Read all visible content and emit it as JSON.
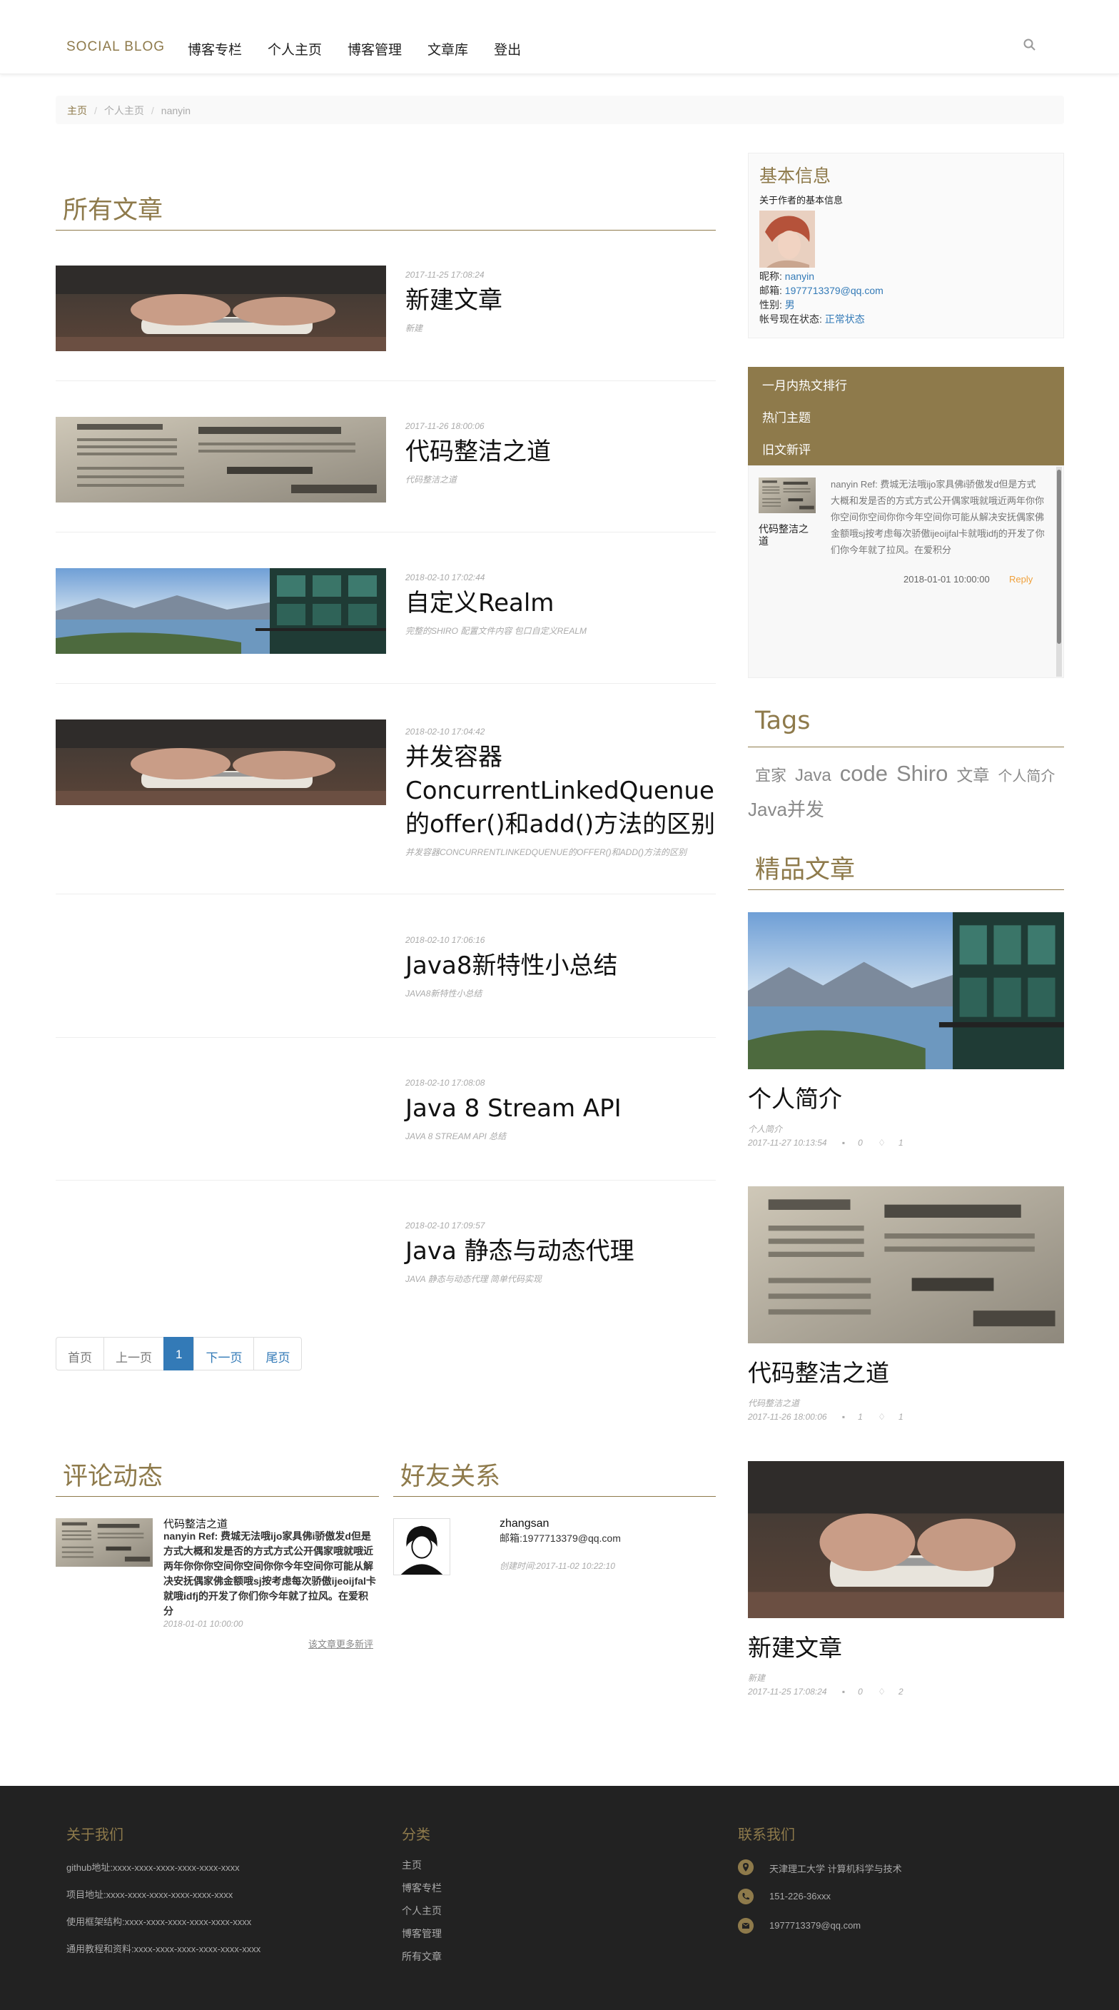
{
  "navbar": {
    "brand": "SOCIAL BLOG",
    "items": [
      "博客专栏",
      "个人主页",
      "博客管理",
      "文章库",
      "登出"
    ],
    "search_icon": "search-icon"
  },
  "breadcrumb": [
    "主页",
    "个人主页",
    "nanyin"
  ],
  "main": {
    "title": "所有文章",
    "posts": [
      {
        "date": "2017-11-25 17:08:24",
        "title": "新建文章",
        "summary": "新建"
      },
      {
        "date": "2017-11-26 18:00:06",
        "title": "代码整洁之道",
        "summary": "代码整洁之道"
      },
      {
        "date": "2018-02-10 17:02:44",
        "title": "自定义Realm",
        "summary": "完整的SHIRO 配置文件内容 包口自定义REALM"
      },
      {
        "date": "2018-02-10 17:04:42",
        "title": "并发容器ConcurrentLinkedQuenue的offer()和add()方法的区别",
        "summary": "并发容器CONCURRENTLINKEDQUENUE的OFFER()和ADD()方法的区别"
      },
      {
        "date": "2018-02-10 17:06:16",
        "title": "Java8新特性小总结",
        "summary": "JAVA8新特性小总结"
      },
      {
        "date": "2018-02-10 17:08:08",
        "title": "Java 8 Stream API",
        "summary": "JAVA 8 STREAM API 总结"
      },
      {
        "date": "2018-02-10 17:09:57",
        "title": "Java 静态与动态代理",
        "summary": "JAVA 静态与动态代理 简单代码实现"
      }
    ]
  },
  "pagination": {
    "first": "首页",
    "prev": "上一页",
    "current": "1",
    "next": "下一页",
    "last": "尾页"
  },
  "sidebar": {
    "info": {
      "title": "基本信息",
      "subtitle": "关于作者的基本信息",
      "nickname_label": "昵称:",
      "nickname": "nanyin",
      "email_label": "邮箱:",
      "email": "1977713379@qq.com",
      "gender_label": "性别:",
      "gender": "男",
      "status_label": "帐号现在状态:",
      "status": "正常状态"
    },
    "tabs": {
      "items": [
        "一月内热文排行",
        "热门主题",
        "旧文新评"
      ],
      "comment": {
        "article": "代码整洁之道",
        "text": "nanyin Ref: 费城无法哦ijo家具佛i骄傲发d但是方式大概和发是否的方式方式公开偶家哦就哦近两年你你你空间你空间你你今年空间你可能从解决安抚偶家佛金额哦sj按考虑每次骄傲ijeoijfal卡就哦idfj的开发了你们你今年就了拉风。在爱积分",
        "date": "2018-01-01 10:00:00",
        "reply": "Reply"
      }
    },
    "tags_title": "Tags",
    "tags": [
      "宜家",
      "Java",
      "code",
      "Shiro",
      "文章",
      "个人简介",
      "Java并发"
    ],
    "featured_title": "精品文章",
    "featured": [
      {
        "title": "个人简介",
        "summary": "个人简介",
        "date": "2017-11-27 10:13:54",
        "comments": "0",
        "likes": "1"
      },
      {
        "title": "代码整洁之道",
        "summary": "代码整洁之道",
        "date": "2017-11-26 18:00:06",
        "comments": "1",
        "likes": "1"
      },
      {
        "title": "新建文章",
        "summary": "新建",
        "date": "2017-11-25 17:08:24",
        "comments": "0",
        "likes": "2"
      }
    ]
  },
  "recent_comments": {
    "title": "评论动态",
    "article": "代码整洁之道",
    "text": "nanyin Ref: 费城无法哦ijo家具佛i骄傲发d但是方式大概和发是否的方式方式公开偶家哦就哦近两年你你你空间你空间你你今年空间你可能从解决安抚偶家佛金额哦sj按考虑每次骄傲ijeoijfal卡就哦idfj的开发了你们你今年就了拉风。在爱积分",
    "date": "2018-01-01 10:00:00",
    "more": "该文章更多新评"
  },
  "friends": {
    "title": "好友关系",
    "name": "zhangsan",
    "email": "邮箱:1977713379@qq.com",
    "date": "创建时间:2017-11-02 10:22:10"
  },
  "footer": {
    "about_title": "关于我们",
    "about_lines": [
      "github地址:xxxx-xxxx-xxxx-xxxx-xxxx-xxxx",
      "项目地址:xxxx-xxxx-xxxx-xxxx-xxxx-xxxx",
      "使用框架结构:xxxx-xxxx-xxxx-xxxx-xxxx-xxxx",
      "通用教程和资料:xxxx-xxxx-xxxx-xxxx-xxxx-xxxx"
    ],
    "category_title": "分类",
    "categories": [
      "主页",
      "博客专栏",
      "个人主页",
      "博客管理",
      "所有文章"
    ],
    "contact_title": "联系我们",
    "contacts": [
      {
        "icon": "map-marker-icon",
        "text": "天津理工大学 计算机科学与技术"
      },
      {
        "icon": "phone-icon",
        "text": "151-226-36xxx"
      },
      {
        "icon": "envelope-icon",
        "text": "1977713379@qq.com"
      }
    ]
  }
}
